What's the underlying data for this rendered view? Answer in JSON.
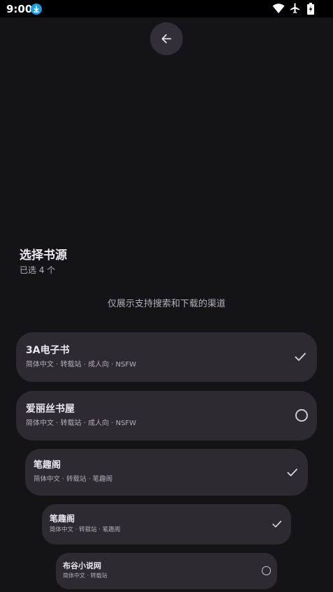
{
  "status_bar": {
    "time": "9:00",
    "icons": [
      "download-icon",
      "wifi-icon",
      "airplane-icon",
      "battery-icon"
    ]
  },
  "header": {
    "back_icon": "arrow-left-icon",
    "title": "选择书源",
    "selected_count": "已选 4 个"
  },
  "hint": "仅展示支持搜索和下载的渠道",
  "sources": [
    {
      "name": "3A电子书",
      "meta": "简体中文 · 转载站 · 成人向 · NSFW",
      "selected": true
    },
    {
      "name": "爱丽丝书屋",
      "meta": "简体中文 · 转载站 · 成人向 · NSFW",
      "selected": false
    },
    {
      "name": "笔趣阁",
      "meta": "简体中文 · 转载站 · 笔趣阁",
      "selected": true
    },
    {
      "name": "笔趣阁",
      "meta": "简体中文 · 转载站 · 笔趣阁",
      "selected": true
    },
    {
      "name": "布谷小说网",
      "meta": "简体中文 · 转载站",
      "selected": false
    }
  ],
  "colors": {
    "background": "#141316",
    "card": "#2d2a32",
    "status_download": "#1a9ee6"
  }
}
